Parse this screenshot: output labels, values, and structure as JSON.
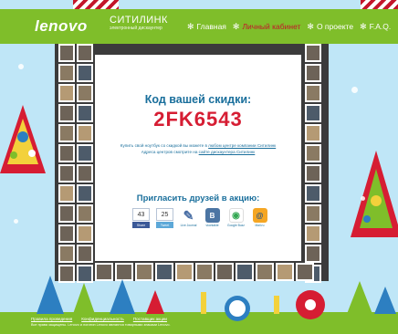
{
  "header": {
    "brand": "lenovo",
    "partner_name": "СИТИЛИНК",
    "partner_tagline": "электронный дискаунтер",
    "nav": [
      {
        "label": "Главная",
        "active": false
      },
      {
        "label": "Личный кабинет",
        "active": true
      },
      {
        "label": "О проекте",
        "active": false
      },
      {
        "label": "F.A.Q.",
        "active": false
      }
    ]
  },
  "card": {
    "title": "Код вашей скидки:",
    "code": "2FK6543",
    "info_line1_pre": "Купить свой ноутбук со скидкой вы можете в ",
    "info_line1_link": "любом центре компании Ситилинк",
    "info_line2_pre": "Адреса центров смотрите на ",
    "info_line2_link": "сайте дискаунтера Ситилинк",
    "invite": "Пригласить друзей в акцию:"
  },
  "share": {
    "facebook": {
      "count": "43",
      "label": "Share"
    },
    "twitter": {
      "count": "25",
      "label": "Tweet"
    },
    "livejournal": {
      "label": "Live Journal"
    },
    "vkontakte": {
      "label": "vkontakte"
    },
    "google": {
      "label": "Google Buzz"
    },
    "mail": {
      "label": "Mail.ru"
    }
  },
  "footer": {
    "links": [
      "Правила проведения",
      "Конфиденциальность",
      "Поставщик акции"
    ],
    "copyright": "Все права защищены. Lenovo и логотип Lenovo являются товарными знаками Lenovo."
  },
  "colors": {
    "header_green": "#7fbe2a",
    "title_blue": "#1a6f9c",
    "code_red": "#d61d33",
    "background": "#bfe6f7"
  }
}
